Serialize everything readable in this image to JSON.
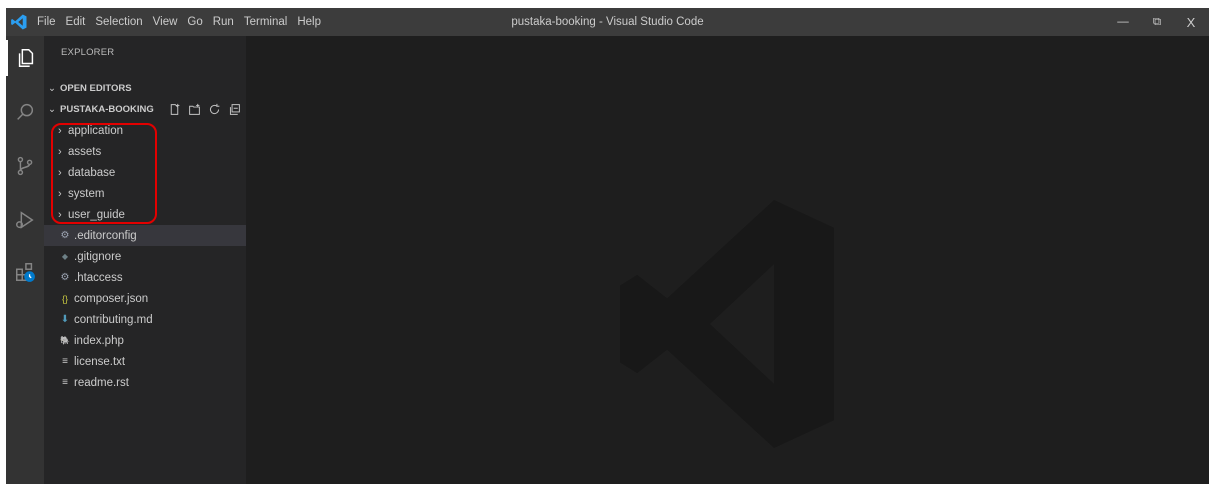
{
  "window": {
    "title": "pustaka-booking - Visual Studio Code",
    "menu": [
      "File",
      "Edit",
      "Selection",
      "View",
      "Go",
      "Run",
      "Terminal",
      "Help"
    ],
    "controls": {
      "minimize": "—",
      "restore": "⧉",
      "close": "X"
    }
  },
  "activity_bar": [
    "files-icon",
    "search-icon",
    "source-control-icon",
    "run-debug-icon",
    "extensions-icon"
  ],
  "sidebar": {
    "title": "EXPLORER",
    "open_editors": "OPEN EDITORS",
    "project": "PUSTAKA-BOOKING",
    "project_actions": [
      "new-file-icon",
      "new-folder-icon",
      "refresh-icon",
      "collapse-all-icon"
    ],
    "folders": [
      "application",
      "assets",
      "database",
      "system",
      "user_guide"
    ],
    "files": [
      {
        "name": ".editorconfig",
        "icon": "gear-icon",
        "color": "#9da5b4",
        "glyph": "⚙"
      },
      {
        "name": ".gitignore",
        "icon": "git-icon",
        "color": "#6d8086",
        "glyph": "◆"
      },
      {
        "name": ".htaccess",
        "icon": "gear-icon",
        "color": "#9da5b4",
        "glyph": "⚙"
      },
      {
        "name": "composer.json",
        "icon": "json-icon",
        "color": "#cbcb41",
        "glyph": "{}"
      },
      {
        "name": "contributing.md",
        "icon": "markdown-icon",
        "color": "#519aba",
        "glyph": "⬇"
      },
      {
        "name": "index.php",
        "icon": "php-icon",
        "color": "#a074c4",
        "glyph": "🐘"
      },
      {
        "name": "license.txt",
        "icon": "text-icon",
        "color": "#cccccc",
        "glyph": "≡"
      },
      {
        "name": "readme.rst",
        "icon": "text-icon",
        "color": "#cccccc",
        "glyph": "≡"
      }
    ],
    "selected_item": ".editorconfig"
  },
  "colors": {
    "titlebar": "#3c3c3c",
    "activity_bar": "#333333",
    "sidebar": "#252526",
    "editor": "#1e1e1e",
    "selection": "#37373d",
    "annotation": "#e30000",
    "accent": "#007acc"
  }
}
